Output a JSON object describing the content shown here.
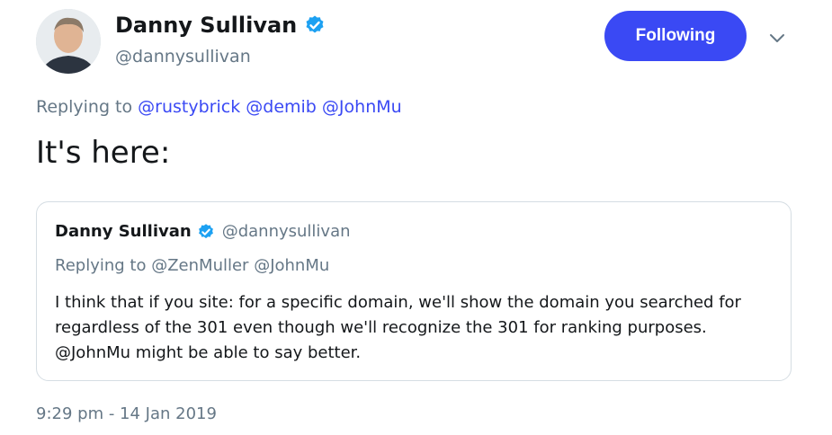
{
  "author": {
    "name": "Danny Sullivan",
    "handle": "@dannysullivan",
    "verified": true,
    "avatar": "avatar-photo"
  },
  "follow_button": {
    "label": "Following",
    "color": "#3a49f4"
  },
  "more_menu": {
    "icon": "chevron-down-icon"
  },
  "tweet": {
    "replying_prefix": "Replying to",
    "mentions": [
      "@rustybrick",
      "@demib",
      "@JohnMu"
    ],
    "text": "It's here:",
    "timestamp": "9:29 pm - 14 Jan 2019"
  },
  "quoted_tweet": {
    "name": "Danny Sullivan",
    "handle": "@dannysullivan",
    "verified": true,
    "replying_prefix": "Replying to",
    "mentions": [
      "@ZenMuller",
      "@JohnMu"
    ],
    "text": "I think that if you site: for a specific domain, we'll show the domain you searched for regardless of the 301 even though we'll recognize the 301 for ranking purposes. @JohnMu might be able to say better."
  },
  "colors": {
    "accent": "#3a49f4",
    "verified": "#1da1f2",
    "muted": "#657786",
    "border": "#d5dde3"
  }
}
